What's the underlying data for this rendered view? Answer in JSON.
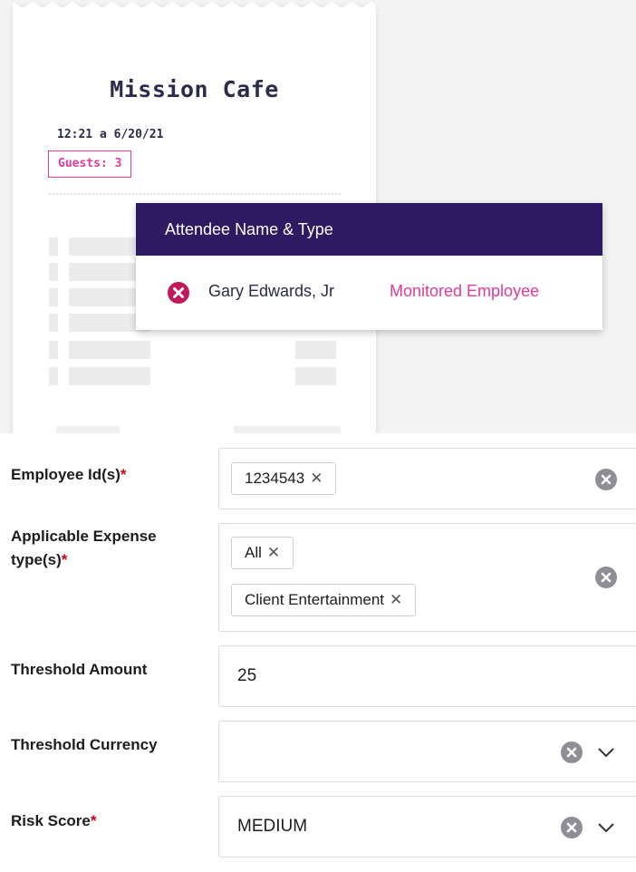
{
  "receipt": {
    "title": "Mission Cafe",
    "datetime": "12:21 a 6/20/21",
    "guests": "Guests: 3"
  },
  "popup": {
    "header": "Attendee Name & Type",
    "attendee_name": "Gary Edwards, Jr",
    "attendee_type": "Monitored Employee",
    "accent_color": "#e2399b",
    "header_color": "#2d1a63"
  },
  "form": {
    "employee_ids": {
      "label": "Employee Id(s)",
      "required_mark": "*",
      "chips": [
        "1234543"
      ]
    },
    "expense_types": {
      "label_line1": "Applicable Expense",
      "label_line2": "type(s)",
      "required_mark": "*",
      "chips": [
        "All",
        "Client Entertainment"
      ]
    },
    "threshold_amount": {
      "label": "Threshold Amount",
      "value": "25"
    },
    "threshold_currency": {
      "label": "Threshold Currency",
      "value": ""
    },
    "risk_score": {
      "label": "Risk Score",
      "required_mark": "*",
      "value": "MEDIUM"
    },
    "chip_remove_glyph": "✕"
  }
}
